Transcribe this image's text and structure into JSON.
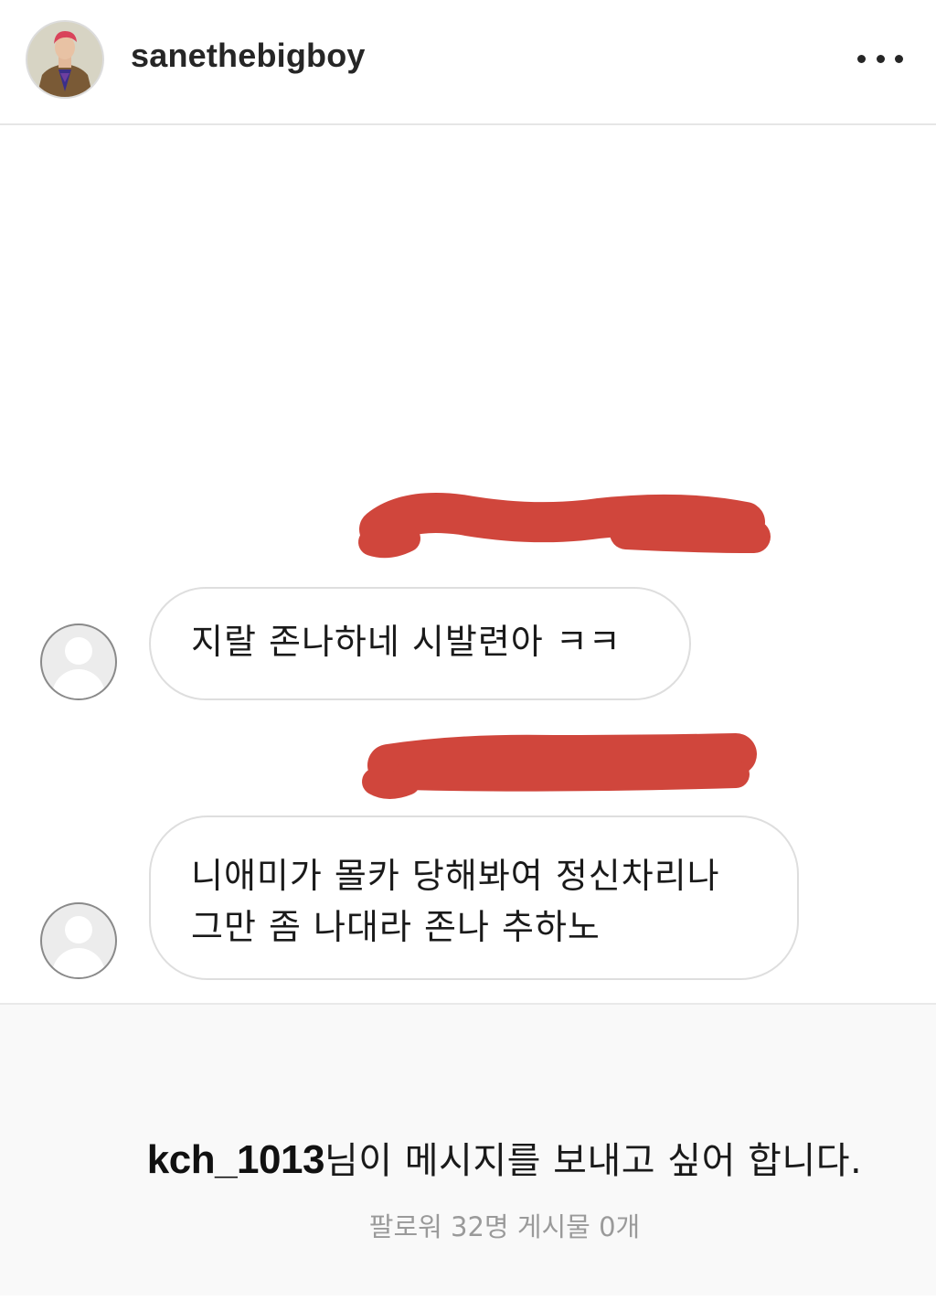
{
  "post": {
    "username": "sanethebigboy",
    "avatar_icon": "profile-photo",
    "more_icon": "more-horizontal-icon"
  },
  "messages": [
    {
      "text_lines": [
        "지랄 존나하네 시발련아 ㅋㅋ"
      ]
    },
    {
      "text_lines": [
        "니애미가 몰카 당해봐여 정신차리나",
        "그만 좀 나대라 존나 추하노"
      ]
    }
  ],
  "request": {
    "username": "kch_1013",
    "suffix": "님이 메시지를 보내고 싶어 합니다.",
    "stats": "팔로워 32명 게시물 0개"
  },
  "colors": {
    "redaction": "#d0463c",
    "bubble_border": "#dedede",
    "request_bg": "#f9f9f9",
    "stats_text": "#9a9a9a"
  }
}
